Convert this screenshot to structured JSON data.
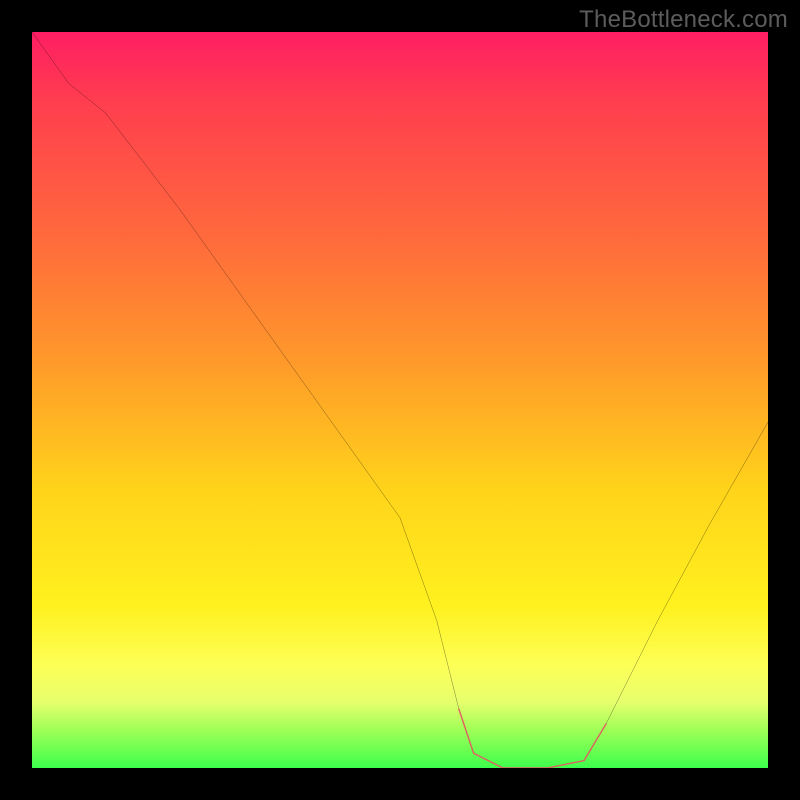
{
  "watermark": "TheBottleneck.com",
  "chart_data": {
    "type": "line",
    "title": "",
    "xlabel": "",
    "ylabel": "",
    "xlim": [
      0,
      100
    ],
    "ylim": [
      0,
      100
    ],
    "grid": false,
    "legend": false,
    "series": [
      {
        "name": "bottleneck-curve",
        "x": [
          0,
          5,
          10,
          20,
          30,
          40,
          50,
          55,
          58,
          60,
          64,
          70,
          75,
          78,
          85,
          92,
          100
        ],
        "y": [
          100,
          93,
          89,
          76,
          62,
          48,
          34,
          20,
          8,
          2,
          0,
          0,
          1,
          6,
          20,
          33,
          47
        ]
      }
    ],
    "highlight": {
      "name": "optimal-range",
      "x": [
        58,
        60,
        64,
        70,
        75,
        78
      ],
      "y": [
        8,
        2,
        0,
        0,
        1,
        6
      ]
    },
    "gradient_stops": [
      {
        "pos": 0.0,
        "color": "#ff1e63"
      },
      {
        "pos": 0.1,
        "color": "#ff3f4e"
      },
      {
        "pos": 0.28,
        "color": "#ff6a3c"
      },
      {
        "pos": 0.45,
        "color": "#ff9a2a"
      },
      {
        "pos": 0.62,
        "color": "#ffd31a"
      },
      {
        "pos": 0.78,
        "color": "#fff11f"
      },
      {
        "pos": 0.86,
        "color": "#fdff56"
      },
      {
        "pos": 0.91,
        "color": "#e7ff6d"
      },
      {
        "pos": 0.95,
        "color": "#9cff56"
      },
      {
        "pos": 1.0,
        "color": "#3dff4d"
      }
    ],
    "colors": {
      "curve": "#000000",
      "highlight": "#e06060"
    }
  }
}
